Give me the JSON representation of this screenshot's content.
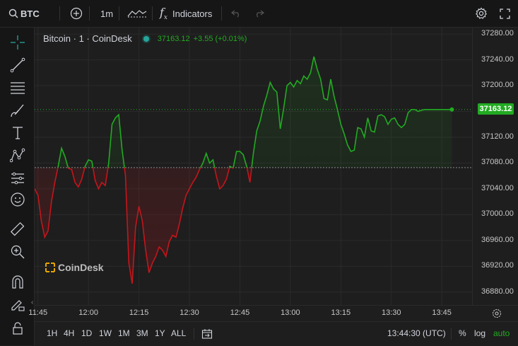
{
  "toolbar": {
    "symbol": "BTC",
    "interval": "1m",
    "indicators_label": "Indicators"
  },
  "legend": {
    "title": "Bitcoin · 1 · CoinDesk",
    "last_value": "37163.12",
    "change": "+3.55 (+0.01%)"
  },
  "price_label": "37163.12",
  "watermark": "CoinDesk",
  "bottom": {
    "ranges": [
      "1H",
      "4H",
      "1D",
      "1W",
      "1M",
      "3M",
      "1Y",
      "ALL"
    ],
    "time": "13:44:30 (UTC)",
    "percent": "%",
    "log": "log",
    "auto": "auto"
  },
  "colors": {
    "up": "#22ab22",
    "down": "#c4161c",
    "accent": "#26a69a"
  },
  "chart_data": {
    "type": "line",
    "baseline": 37073,
    "ylim": [
      36860,
      37290
    ],
    "y_ticks": [
      37280.0,
      37240.0,
      37200.0,
      37160.0,
      37120.0,
      37080.0,
      37040.0,
      37000.0,
      36960.0,
      36920.0,
      36880.0
    ],
    "x_ticks": [
      "11:45",
      "12:00",
      "12:15",
      "12:30",
      "12:45",
      "13:00",
      "13:15",
      "13:30",
      "13:45"
    ],
    "x_tick_minutes": [
      705,
      720,
      735,
      750,
      765,
      780,
      795,
      810,
      825
    ],
    "xlim_minutes": [
      704,
      834
    ],
    "series": [
      {
        "x_minutes": [
          704,
          705,
          706,
          707,
          708,
          709,
          710,
          711,
          712,
          713,
          714,
          715,
          716,
          717,
          718,
          719,
          720,
          721,
          722,
          723,
          724,
          725,
          726,
          727,
          728,
          729,
          730,
          731,
          732,
          733,
          734,
          735,
          736,
          737,
          738,
          739,
          740,
          741,
          742,
          743,
          744,
          745,
          746,
          747,
          748,
          749,
          750,
          751,
          752,
          753,
          754,
          755,
          756,
          757,
          758,
          759,
          760,
          761,
          762,
          763,
          764,
          765,
          766,
          767,
          768,
          769,
          770,
          771,
          772,
          773,
          774,
          775,
          776,
          777,
          778,
          779,
          780,
          781,
          782,
          783,
          784,
          785,
          786,
          787,
          788,
          789,
          790,
          791,
          792,
          793,
          794,
          795,
          796,
          797,
          798,
          799,
          800,
          801,
          802,
          803,
          804,
          805,
          806,
          807,
          808,
          809,
          810,
          811,
          812,
          813,
          814,
          815,
          816,
          817,
          818,
          819,
          820,
          821,
          822,
          823,
          824,
          825,
          826,
          827,
          828
        ],
        "values": [
          37040,
          37030,
          36990,
          36965,
          36975,
          37020,
          37050,
          37075,
          37103,
          37090,
          37072,
          37070,
          37050,
          37043,
          37055,
          37075,
          37085,
          37083,
          37053,
          37040,
          37050,
          37045,
          37080,
          37140,
          37150,
          37155,
          37100,
          37060,
          36925,
          36893,
          36980,
          37013,
          36990,
          36945,
          36910,
          36925,
          36935,
          36950,
          36945,
          36935,
          36958,
          36968,
          36965,
          36985,
          37010,
          37030,
          37040,
          37050,
          37058,
          37070,
          37080,
          37095,
          37080,
          37085,
          37060,
          37040,
          37045,
          37055,
          37075,
          37072,
          37098,
          37098,
          37093,
          37075,
          37050,
          37095,
          37130,
          37145,
          37168,
          37185,
          37205,
          37195,
          37190,
          37133,
          37165,
          37200,
          37205,
          37198,
          37208,
          37203,
          37215,
          37210,
          37220,
          37245,
          37225,
          37210,
          37180,
          37178,
          37210,
          37183,
          37163,
          37140,
          37125,
          37108,
          37098,
          37100,
          37135,
          37133,
          37120,
          37150,
          37130,
          37128,
          37153,
          37155,
          37152,
          37140,
          37148,
          37150,
          37140,
          37135,
          37140,
          37158,
          37163,
          37163,
          37160,
          37162,
          37163,
          37163,
          37163,
          37163,
          37163,
          37163,
          37163,
          37163,
          37163
        ]
      }
    ]
  }
}
